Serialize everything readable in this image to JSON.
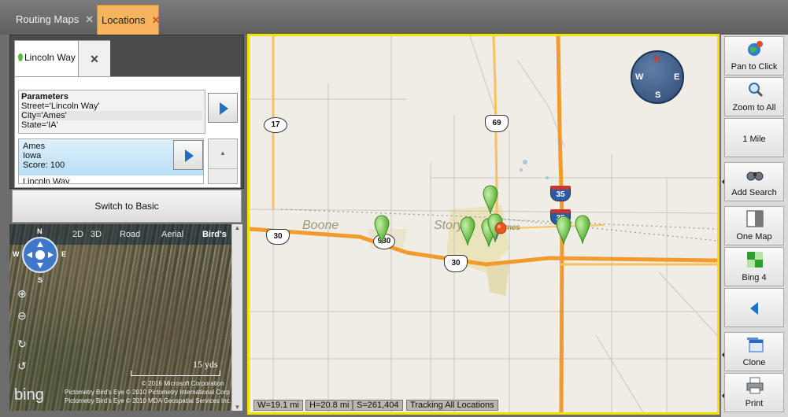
{
  "tabs": [
    {
      "label": "Routing Maps",
      "active": false
    },
    {
      "label": "Locations",
      "active": true
    }
  ],
  "location_tab": {
    "label": "Lincoln Way",
    "close": "✕"
  },
  "parameters": {
    "title": "Parameters",
    "street": "Street='Lincoln Way'",
    "city": "City='Ames'",
    "state": "State='IA'"
  },
  "result": {
    "line1": "Ames",
    "line2": "Iowa",
    "line3": "Score:  100",
    "next_line": "Lincoln Way"
  },
  "switch_label": "Switch to Basic",
  "aerial": {
    "views": [
      "2D",
      "3D",
      "Road",
      "Aerial",
      "Bird's"
    ],
    "active_view": "Bird's",
    "compass": {
      "n": "N",
      "e": "E",
      "s": "S",
      "w": "W"
    },
    "scale": "15 yds",
    "copyright": [
      "© 2016 Microsoft Corporation",
      "Pictometry Bird's Eye © 2010 Pictometry International Corp",
      "Pictometry Bird's Eye © 2010 MDA Geospatial Services Inc."
    ],
    "brand": "bing"
  },
  "map": {
    "labels": {
      "boone": "Boone",
      "story": "Story",
      "ames": "Ames"
    },
    "shields": [
      "17",
      "69",
      "30",
      "930",
      "30",
      "35",
      "35"
    ],
    "compass": {
      "n": "N",
      "e": "E",
      "s": "S",
      "w": "W"
    },
    "status": [
      "W=19.1 mi",
      "H=20.8 mi",
      "S=261,404",
      "Tracking All Locations"
    ]
  },
  "toolbar": [
    {
      "label": "Pan to Click",
      "icon": "globe-pan-icon"
    },
    {
      "label": "Zoom to All",
      "icon": "magnifier-icon"
    },
    {
      "label": "1 Mile",
      "icon": ""
    },
    {
      "label": "Add Search",
      "icon": "binoculars-icon"
    },
    {
      "label": "One Map",
      "icon": "one-map-icon"
    },
    {
      "label": "Bing 4",
      "icon": "bing-four-icon"
    },
    {
      "label": "",
      "icon": "collapse-left-icon"
    },
    {
      "label": "Clone",
      "icon": "clone-window-icon"
    },
    {
      "label": "Print",
      "icon": "printer-icon"
    }
  ],
  "colors": {
    "accent_tab": "#f7b45e",
    "map_border": "#f3e200",
    "highway": "#f39a2c",
    "pin_green": "#5dbb3b",
    "pin_orange": "#e8581e"
  }
}
